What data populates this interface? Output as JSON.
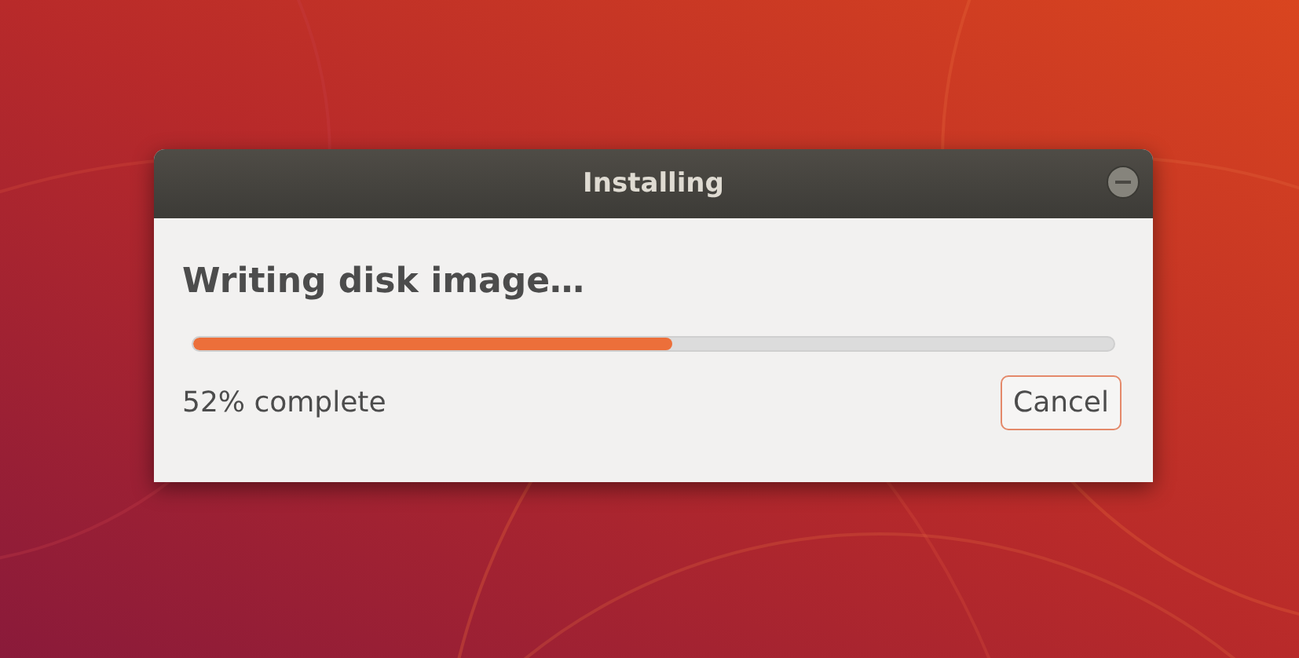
{
  "window": {
    "title": "Installing"
  },
  "status": {
    "heading": "Writing disk image…",
    "progress": {
      "level": 0.52
    },
    "reading": "52% complete"
  },
  "buttons": [
    {
      "label": "Cancel"
    }
  ]
}
